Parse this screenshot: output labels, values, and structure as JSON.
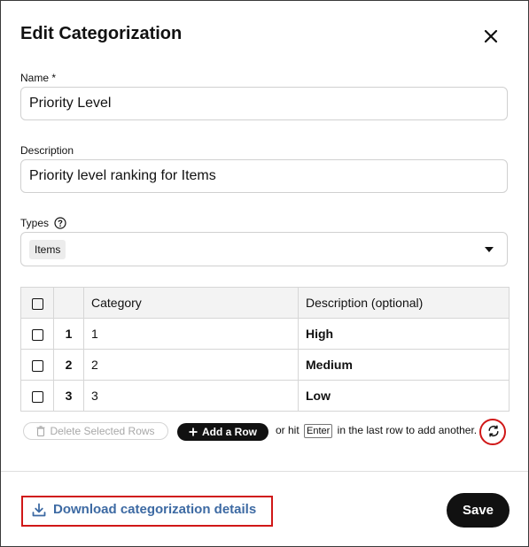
{
  "dialog": {
    "title": "Edit Categorization"
  },
  "name_field": {
    "label": "Name *",
    "value": "Priority Level"
  },
  "description_field": {
    "label": "Description",
    "value": "Priority level ranking for Items"
  },
  "types_field": {
    "label": "Types",
    "selected_chip": "Items"
  },
  "table": {
    "headers": {
      "category": "Category",
      "description": "Description (optional)"
    },
    "rows": [
      {
        "number": "1",
        "category": "1",
        "description": "High"
      },
      {
        "number": "2",
        "category": "2",
        "description": "Medium"
      },
      {
        "number": "3",
        "category": "3",
        "description": "Low"
      }
    ]
  },
  "toolbar": {
    "delete_label": "Delete Selected Rows",
    "add_label": "Add a Row",
    "hint_prefix": "or hit",
    "hint_key": "Enter",
    "hint_suffix": "in the last row to add another."
  },
  "footer": {
    "download_label": "Download categorization details",
    "save_label": "Save"
  },
  "colors": {
    "accent_link": "#3d6aa3",
    "highlight_red": "#d01717",
    "primary_button": "#111111"
  },
  "icons": {
    "close": "close-icon",
    "help": "help-circle-icon",
    "dropdown": "caret-down-icon",
    "delete": "trash-icon",
    "add": "plus-icon",
    "refresh": "refresh-icon",
    "download": "download-icon"
  }
}
